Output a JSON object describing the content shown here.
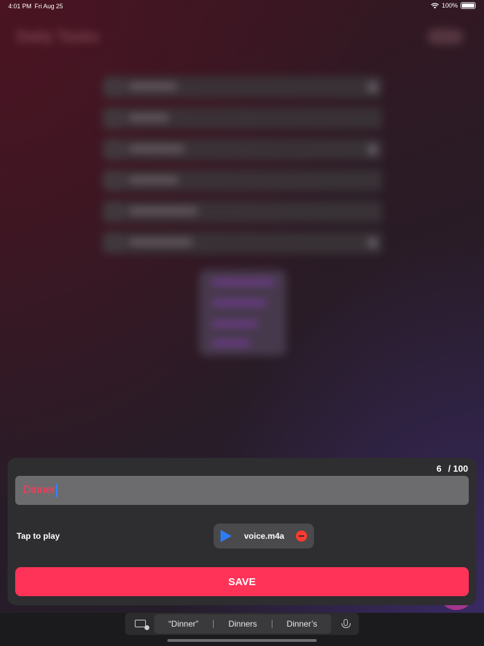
{
  "status_bar": {
    "time": "4:01 PM",
    "date": "Fri Aug 25",
    "battery": "100%"
  },
  "background": {
    "title": "Daily Tasks",
    "tasks": [
      "Shopping",
      "Walking",
      "Homework",
      "Breakfast",
      "Take a shower",
      "Wake up early"
    ]
  },
  "sheet": {
    "counter_value": "6",
    "counter_max": "/ 100",
    "input_value": "Dinner",
    "tap_label": "Tap to play",
    "audio_file": "voice.m4a",
    "save_label": "SAVE"
  },
  "keyboard": {
    "suggestions": [
      "“Dinner”",
      "Dinners",
      "Dinner’s"
    ]
  },
  "colors": {
    "accent": "#ff3358",
    "play": "#2d7cf6",
    "remove": "#ff3b30"
  }
}
